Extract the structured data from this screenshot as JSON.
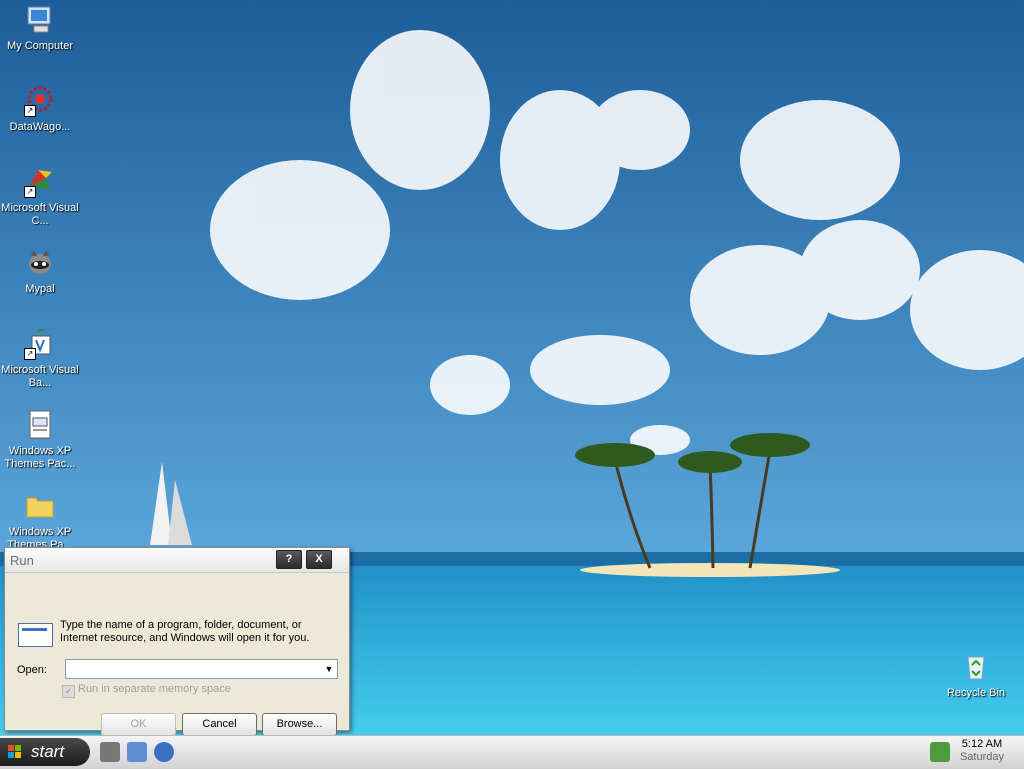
{
  "desktop": {
    "icons": [
      {
        "label": "My Computer"
      },
      {
        "label": "DataWago..."
      },
      {
        "label": "Microsoft Visual C..."
      },
      {
        "label": "Mypal"
      },
      {
        "label": "Microsoft Visual Ba..."
      },
      {
        "label": "Windows XP Themes Pac..."
      },
      {
        "label": "Windows XP Themes Pa..."
      },
      {
        "label": "Recycle Bin"
      }
    ]
  },
  "run_dialog": {
    "title": "Run",
    "help_button": "?",
    "close_button": "X",
    "description": "Type the name of a program, folder, document, or Internet resource, and Windows will open it for you.",
    "open_label": "Open:",
    "open_value": "",
    "checkbox_label": "Run in separate memory space",
    "checkbox_checked": true,
    "ok_label": "OK",
    "cancel_label": "Cancel",
    "browse_label": "Browse..."
  },
  "taskbar": {
    "start_label": "start",
    "clock_time": "5:12 AM",
    "clock_day": "Saturday"
  }
}
